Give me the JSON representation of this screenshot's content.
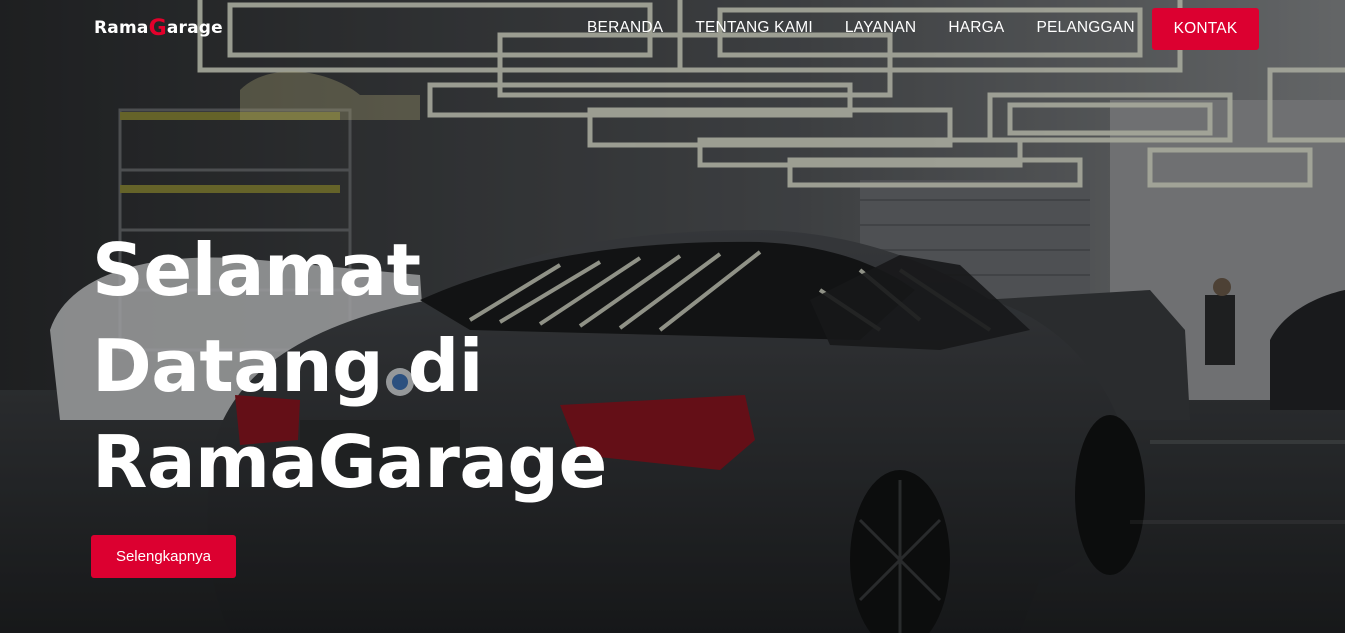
{
  "brand": {
    "logo_prefix": "Rama",
    "logo_mark": "G",
    "logo_suffix": "arage",
    "accent_color": "#dc0030"
  },
  "nav": {
    "items": [
      {
        "label": "BERANDA"
      },
      {
        "label": "TENTANG KAMI"
      },
      {
        "label": "LAYANAN"
      },
      {
        "label": "HARGA"
      },
      {
        "label": "PELANGGAN"
      }
    ],
    "contact_label": "KONTAK"
  },
  "hero": {
    "headline": "Selamat Datang di RamaGarage",
    "cta_label": "Selengkapnya",
    "background_image": "car-garage-photo"
  }
}
